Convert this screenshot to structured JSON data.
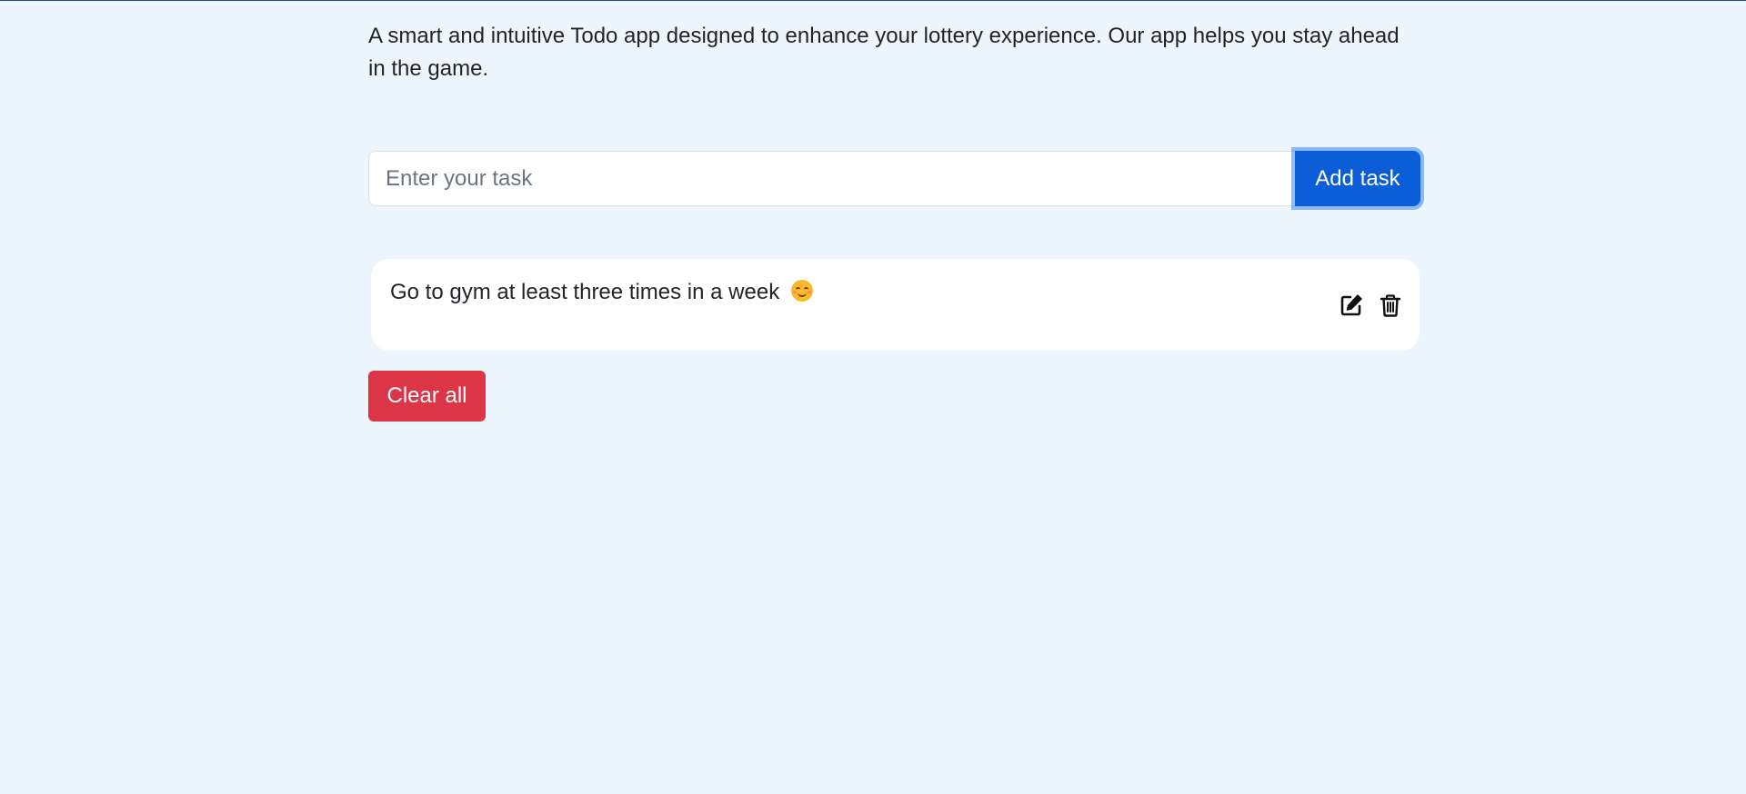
{
  "app": {
    "description": "A smart and intuitive Todo app designed to enhance your lottery experience. Our app helps you stay ahead in the game."
  },
  "task_form": {
    "input_value": "",
    "input_placeholder": "Enter your task",
    "add_label": "Add task"
  },
  "tasks": [
    {
      "text": "Go to gym at least three times in a week",
      "emoji_icon": "smiling-face-icon",
      "actions": [
        "edit-icon",
        "trash-icon"
      ]
    }
  ],
  "clear_all_label": "Clear all",
  "colors": {
    "background": "#edf5ff",
    "primary": "#0b5ed7",
    "danger": "#dc3545"
  }
}
